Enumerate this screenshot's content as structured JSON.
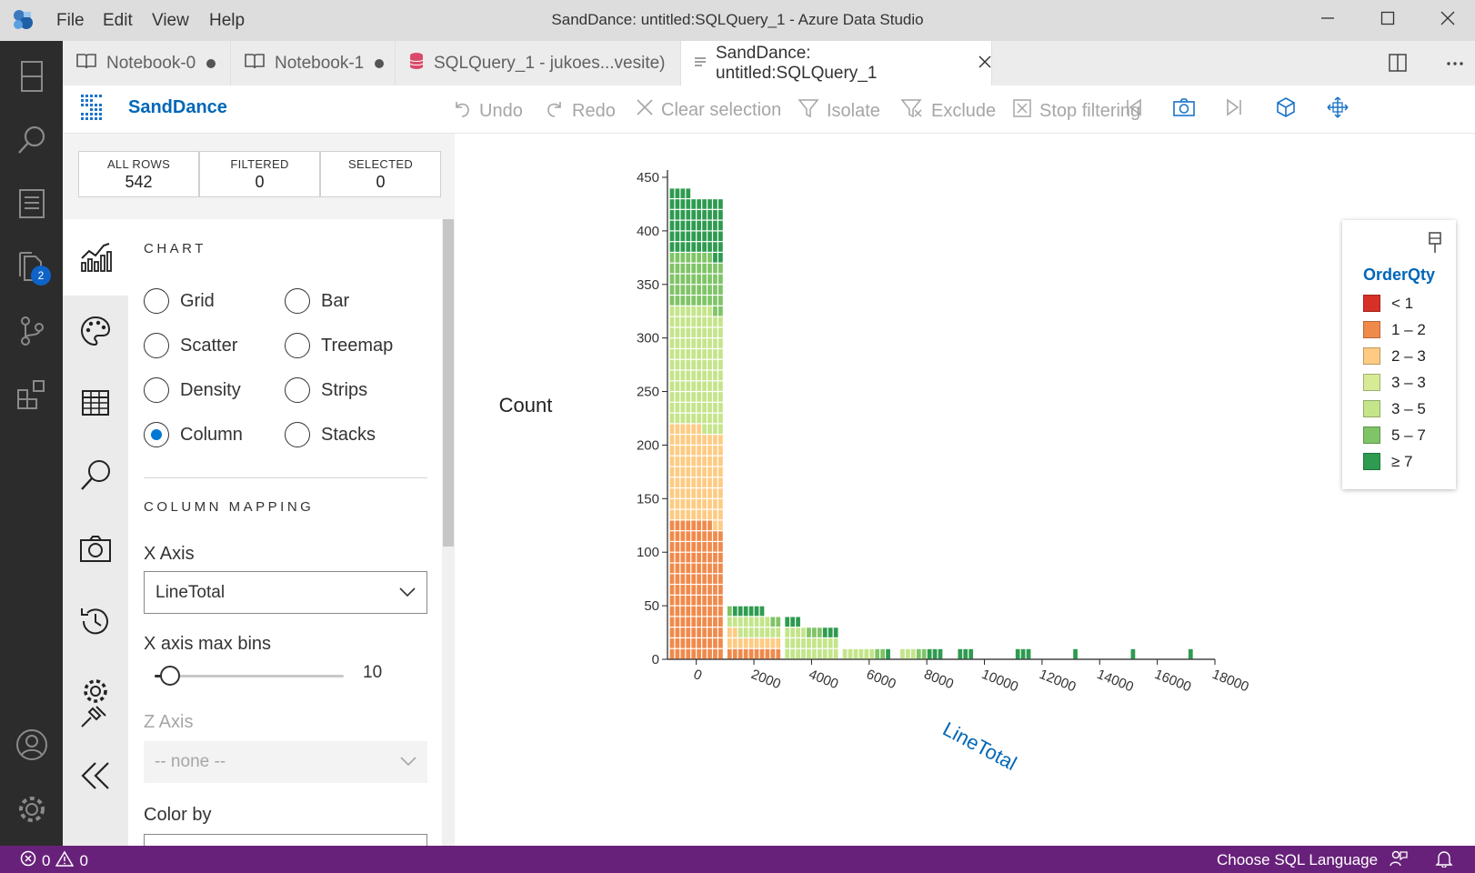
{
  "app": {
    "title": "SandDance: untitled:SQLQuery_1 - Azure Data Studio",
    "menu": [
      "File",
      "Edit",
      "View",
      "Help"
    ]
  },
  "activity_bar": {
    "icons": [
      "explorer-icon",
      "search-icon",
      "notebook-icon",
      "files-icon",
      "source-control-icon",
      "extensions-icon",
      "account-icon",
      "settings-icon"
    ],
    "badge": "2"
  },
  "tabs": [
    {
      "label": "Notebook-0",
      "icon": "book-icon",
      "dirty": true
    },
    {
      "label": "Notebook-1",
      "icon": "book-icon",
      "dirty": true
    },
    {
      "label": "SQLQuery_1 - jukoes...vesite)",
      "icon": "database-icon",
      "dirty": false
    },
    {
      "label": "SandDance: untitled:SQLQuery_1",
      "icon": "preview-icon",
      "active": true
    }
  ],
  "toolbar": {
    "brand": "SandDance",
    "undo": "Undo",
    "redo": "Redo",
    "clear_selection": "Clear selection",
    "isolate": "Isolate",
    "exclude": "Exclude",
    "stop_filtering": "Stop filtering"
  },
  "stats": [
    {
      "label": "ALL ROWS",
      "value": "542"
    },
    {
      "label": "FILTERED",
      "value": "0"
    },
    {
      "label": "SELECTED",
      "value": "0"
    }
  ],
  "panel": {
    "chart_heading": "CHART",
    "chart_types": [
      {
        "label": "Grid",
        "selected": false
      },
      {
        "label": "Bar",
        "selected": false
      },
      {
        "label": "Scatter",
        "selected": false
      },
      {
        "label": "Treemap",
        "selected": false
      },
      {
        "label": "Density",
        "selected": false
      },
      {
        "label": "Strips",
        "selected": false
      },
      {
        "label": "Column",
        "selected": true
      },
      {
        "label": "Stacks",
        "selected": false
      }
    ],
    "mapping_heading": "COLUMN MAPPING",
    "x_axis_label": "X Axis",
    "x_axis_value": "LineTotal",
    "bins_label": "X axis max bins",
    "bins_value": "10",
    "bins_fraction": 0.08,
    "z_axis_label": "Z Axis",
    "z_axis_value": "-- none --",
    "color_by_label": "Color by"
  },
  "colors": {
    "accent": "#0078d4",
    "statusbar": "#68217a",
    "brand_blue": "#0067b8"
  },
  "chart_data": {
    "type": "bar",
    "stacked": true,
    "ylabel": "Count",
    "xlabel": "LineTotal",
    "yticks": [
      0,
      50,
      100,
      150,
      200,
      250,
      300,
      350,
      400,
      450
    ],
    "xticks": [
      "0",
      "2000",
      "4000",
      "6000",
      "8000",
      "10000",
      "12000",
      "14000",
      "16000",
      "18000"
    ],
    "ylim": [
      0,
      450
    ],
    "xlim": [
      -1000,
      18000
    ],
    "bins": [
      {
        "x0": -1000,
        "x1": 1000,
        "counts": {
          "< 1": 0,
          "1 – 2": 128,
          "2 – 3": 88,
          "3 – 3": 0,
          "3 – 5": 112,
          "5 – 7": 50,
          "≥ 7": 56
        }
      },
      {
        "x0": 1000,
        "x1": 3000,
        "counts": {
          "< 1": 0,
          "1 – 2": 10,
          "2 – 3": 12,
          "3 – 3": 0,
          "3 – 5": 16,
          "5 – 7": 3,
          "≥ 7": 6
        }
      },
      {
        "x0": 3000,
        "x1": 5000,
        "counts": {
          "< 1": 0,
          "1 – 2": 0,
          "2 – 3": 0,
          "3 – 3": 0,
          "3 – 5": 24,
          "5 – 7": 3,
          "≥ 7": 6
        }
      },
      {
        "x0": 5000,
        "x1": 7000,
        "counts": {
          "< 1": 0,
          "1 – 2": 0,
          "2 – 3": 0,
          "3 – 3": 0,
          "3 – 5": 6,
          "5 – 7": 2,
          "≥ 7": 1
        }
      },
      {
        "x0": 7000,
        "x1": 9000,
        "counts": {
          "< 1": 0,
          "1 – 2": 0,
          "2 – 3": 0,
          "3 – 3": 0,
          "3 – 5": 3,
          "5 – 7": 2,
          "≥ 7": 3
        }
      },
      {
        "x0": 9000,
        "x1": 11000,
        "counts": {
          "< 1": 0,
          "1 – 2": 0,
          "2 – 3": 0,
          "3 – 3": 0,
          "3 – 5": 0,
          "5 – 7": 0,
          "≥ 7": 3
        }
      },
      {
        "x0": 11000,
        "x1": 13000,
        "counts": {
          "< 1": 0,
          "1 – 2": 0,
          "2 – 3": 0,
          "3 – 3": 0,
          "3 – 5": 0,
          "5 – 7": 0,
          "≥ 7": 3
        }
      },
      {
        "x0": 13000,
        "x1": 15000,
        "counts": {
          "< 1": 0,
          "1 – 2": 0,
          "2 – 3": 0,
          "3 – 3": 0,
          "3 – 5": 0,
          "5 – 7": 0,
          "≥ 7": 1
        }
      },
      {
        "x0": 15000,
        "x1": 17000,
        "counts": {
          "< 1": 0,
          "1 – 2": 0,
          "2 – 3": 0,
          "3 – 3": 0,
          "3 – 5": 0,
          "5 – 7": 0,
          "≥ 7": 1
        }
      },
      {
        "x0": 17000,
        "x1": 19000,
        "counts": {
          "< 1": 0,
          "1 – 2": 0,
          "2 – 3": 0,
          "3 – 3": 0,
          "3 – 5": 0,
          "5 – 7": 0,
          "≥ 7": 1
        }
      }
    ],
    "legend": {
      "title": "OrderQty",
      "position": "top-right",
      "items": [
        {
          "label": "< 1",
          "color": "#d73027"
        },
        {
          "label": "1 – 2",
          "color": "#f08a4b"
        },
        {
          "label": "2 – 3",
          "color": "#fdcb83"
        },
        {
          "label": "3 – 3",
          "color": "#d7ea96"
        },
        {
          "label": "3 – 5",
          "color": "#c4e58a"
        },
        {
          "label": "5 – 7",
          "color": "#7fc466"
        },
        {
          "label": "≥ 7",
          "color": "#2e9b50"
        }
      ]
    }
  },
  "statusbar": {
    "errors": "0",
    "warnings": "0",
    "language": "Choose SQL Language"
  }
}
